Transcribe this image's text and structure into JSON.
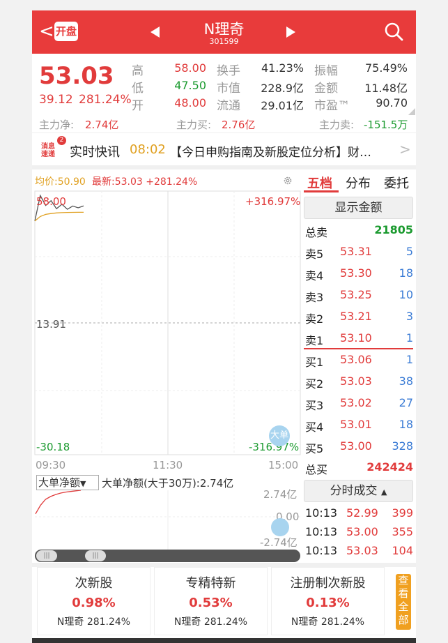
{
  "header": {
    "back_symbol": "<",
    "open_label": "开盘",
    "stock_name": "N理奇",
    "stock_code": "301599"
  },
  "quote": {
    "price": "53.03",
    "change": "39.12",
    "change_pct": "281.24%",
    "high_label": "高",
    "high": "58.00",
    "low_label": "低",
    "low": "47.50",
    "open_label": "开",
    "open": "48.00",
    "turnover_label": "换手",
    "turnover": "41.23%",
    "mcap_label": "市值",
    "mcap": "228.9亿",
    "float_label": "流通",
    "float": "29.01亿",
    "amplitude_label": "振幅",
    "amplitude": "75.49%",
    "amount_label": "金额",
    "amount": "11.48亿",
    "pe_label": "市盈™",
    "pe": "90.70"
  },
  "flows": {
    "net_label": "主力净:",
    "net": "2.74亿",
    "buy_label": "主力买:",
    "buy": "2.76亿",
    "sell_label": "主力卖:",
    "sell": "-151.5万"
  },
  "news": {
    "badge_text": "消息速递",
    "badge_count": "2",
    "label": "实时快讯",
    "time": "08:02",
    "headline": "【今日申购指南及新股定位分析】财…",
    "chevron": ">"
  },
  "chart": {
    "avg_label": "均价:50.90",
    "last_label": "最新:53.03 +281.24%",
    "y_top": "58.00",
    "y_top_pct": "+316.97%",
    "y_mid": "13.91",
    "y_bottom": "-30.18",
    "y_bottom_pct": "-316.97%",
    "x_start": "09:30",
    "x_mid": "11:30",
    "x_end": "15:00",
    "big_order_badge": "大单",
    "select_label": "大单净额",
    "select_arrow": "▼",
    "indicator_text": "大单净额(大于30万):2.74亿",
    "sub_top": "2.74亿",
    "sub_mid": "0.00",
    "sub_bottom": "-2.74亿"
  },
  "chart_data": {
    "type": "line",
    "title": "",
    "x_range": [
      "09:30",
      "15:00"
    ],
    "ylim": [
      -30.18,
      58.0
    ],
    "series": [
      {
        "name": "",
        "values": [
          48.0,
          56.5,
          53.2,
          54.8,
          52.1,
          53.6,
          51.9,
          53.0,
          52.4,
          53.03
        ]
      },
      {
        "name": "均价",
        "values": [
          48.0,
          49.5,
          50.2,
          50.5,
          50.7,
          50.8,
          50.85,
          50.88,
          50.9,
          50.9
        ]
      }
    ],
    "sub_series": {
      "name": "大单净额",
      "ylim": [
        -2.74,
        2.74
      ],
      "values": [
        0.3,
        1.2,
        1.8,
        2.1,
        2.3,
        2.45,
        2.55,
        2.62,
        2.68,
        2.74
      ]
    }
  },
  "orderbook": {
    "tabs": [
      "五档",
      "分布",
      "委托"
    ],
    "show_amount": "显示金额",
    "total_sell_label": "总卖",
    "total_sell": "21805",
    "asks": [
      {
        "label": "卖5",
        "price": "53.31",
        "vol": "5"
      },
      {
        "label": "卖4",
        "price": "53.30",
        "vol": "18"
      },
      {
        "label": "卖3",
        "price": "53.25",
        "vol": "10"
      },
      {
        "label": "卖2",
        "price": "53.21",
        "vol": "3"
      },
      {
        "label": "卖1",
        "price": "53.10",
        "vol": "1"
      }
    ],
    "bids": [
      {
        "label": "买1",
        "price": "53.06",
        "vol": "1"
      },
      {
        "label": "买2",
        "price": "53.03",
        "vol": "38"
      },
      {
        "label": "买3",
        "price": "53.02",
        "vol": "27"
      },
      {
        "label": "买4",
        "price": "53.01",
        "vol": "18"
      },
      {
        "label": "买5",
        "price": "53.00",
        "vol": "328"
      }
    ],
    "total_buy_label": "总买",
    "total_buy": "242424",
    "ticks_label": "分时成交",
    "ticks": [
      {
        "time": "10:13",
        "price": "52.99",
        "vol": "399"
      },
      {
        "time": "10:13",
        "price": "53.00",
        "vol": "355"
      },
      {
        "time": "10:13",
        "price": "53.03",
        "vol": "104"
      }
    ]
  },
  "tiles": [
    {
      "title": "次新股",
      "pct": "0.98%",
      "sub": "N理奇 281.24%"
    },
    {
      "title": "专精特新",
      "pct": "0.53%",
      "sub": "N理奇 281.24%"
    },
    {
      "title": "注册制次新股",
      "pct": "0.13%",
      "sub": "N理奇 281.24%"
    }
  ],
  "side_tag": "查看全部"
}
